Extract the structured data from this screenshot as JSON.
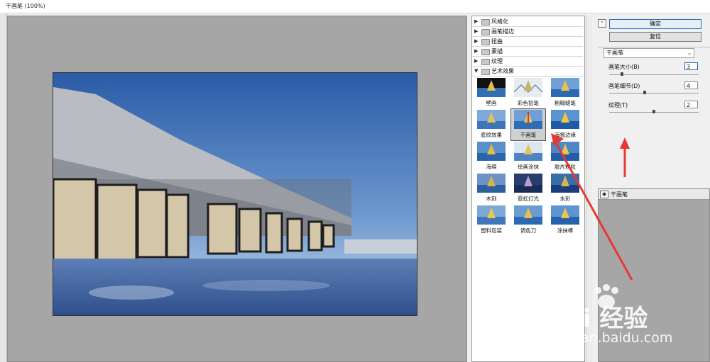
{
  "window": {
    "title": "干画笔 (100%)"
  },
  "folders": [
    {
      "label": "风格化",
      "expanded": false
    },
    {
      "label": "画笔描边",
      "expanded": false
    },
    {
      "label": "扭曲",
      "expanded": false
    },
    {
      "label": "素描",
      "expanded": false
    },
    {
      "label": "纹理",
      "expanded": false
    },
    {
      "label": "艺术效果",
      "expanded": true
    }
  ],
  "filters": [
    {
      "label": "壁画"
    },
    {
      "label": "彩色铅笔"
    },
    {
      "label": "粗糙蜡笔"
    },
    {
      "label": "底纹效果"
    },
    {
      "label": "干画笔",
      "selected": true
    },
    {
      "label": "海报边缘"
    },
    {
      "label": "海绵"
    },
    {
      "label": "绘画涂抹"
    },
    {
      "label": "胶片颗粒"
    },
    {
      "label": "木刻"
    },
    {
      "label": "霓虹灯光"
    },
    {
      "label": "水彩"
    },
    {
      "label": "塑料包装"
    },
    {
      "label": "调色刀"
    },
    {
      "label": "涂抹棒"
    }
  ],
  "buttons": {
    "ok": "确定",
    "reset": "复位"
  },
  "settings": {
    "filter_select": "干画笔",
    "params": [
      {
        "label": "画笔大小(B)",
        "value": "3",
        "level": 0.15
      },
      {
        "label": "画笔细节(D)",
        "value": "4",
        "level": 0.4
      },
      {
        "label": "纹理(T)",
        "value": "2",
        "level": 0.5
      }
    ]
  },
  "layers": [
    {
      "label": "干画笔"
    }
  ],
  "watermark": {
    "brand": "Bai 经验",
    "url": "jingyan.baidu.com"
  },
  "colors": {
    "preview_bg": "#a6a6a6",
    "accent": "#2b6cb0",
    "annotation": "#e53935"
  }
}
